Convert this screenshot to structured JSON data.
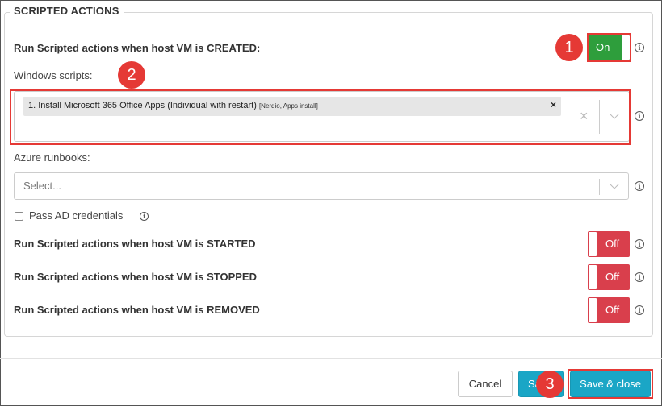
{
  "section": {
    "title": "SCRIPTED ACTIONS"
  },
  "created": {
    "label": "Run Scripted actions when host VM is CREATED:",
    "toggle": "On"
  },
  "windows_scripts": {
    "label": "Windows scripts:",
    "selected_item": "1. Install Microsoft 365 Office Apps (Individual with restart)",
    "selected_tags": "[Nerdio, Apps install]",
    "remove_glyph": "×",
    "clear_glyph": "×"
  },
  "azure_runbooks": {
    "label": "Azure runbooks:",
    "placeholder": "Select..."
  },
  "pass_ad": {
    "label": "Pass AD credentials",
    "checked": false
  },
  "started": {
    "label": "Run Scripted actions when host VM is STARTED",
    "toggle": "Off"
  },
  "stopped": {
    "label": "Run Scripted actions when host VM is STOPPED",
    "toggle": "Off"
  },
  "removed": {
    "label": "Run Scripted actions when host VM is REMOVED",
    "toggle": "Off"
  },
  "info_glyph": "i",
  "footer": {
    "cancel": "Cancel",
    "save": "Save",
    "save_close": "Save & close"
  },
  "annotations": [
    "1",
    "2",
    "3"
  ],
  "colors": {
    "toggle_on": "#2e9e3c",
    "toggle_off": "#d93f4c",
    "primary_button": "#1aa6c6",
    "highlight": "#e53935"
  }
}
